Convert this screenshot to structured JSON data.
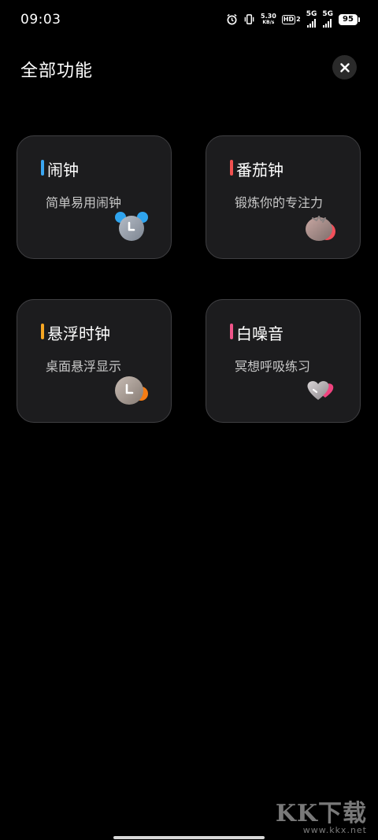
{
  "status_bar": {
    "time": "09:03",
    "net_speed_value": "5.30",
    "net_speed_unit": "KB/s",
    "hd_label": "HD",
    "hd_sub": "2",
    "sim1_label": "5G",
    "sim2_label": "5G",
    "battery": "95",
    "icons": [
      "alarm-icon",
      "vibrate-icon",
      "signal-icon",
      "signal-icon"
    ]
  },
  "header": {
    "title": "全部功能",
    "close_icon": "close-icon"
  },
  "cards": [
    {
      "title": "闹钟",
      "subtitle": "简单易用闹钟",
      "accent": "#3aa6f2",
      "icon": "alarm-clock-icon"
    },
    {
      "title": "番茄钟",
      "subtitle": "锻炼你的专注力",
      "accent": "#f0504f",
      "icon": "tomato-icon"
    },
    {
      "title": "悬浮时钟",
      "subtitle": "桌面悬浮显示",
      "accent": "#f6a623",
      "icon": "floating-clock-icon"
    },
    {
      "title": "白噪音",
      "subtitle": "冥想呼吸练习",
      "accent": "#f0558a",
      "icon": "heart-icon"
    }
  ],
  "watermark": {
    "logo": "KK下载",
    "url": "www.kkx.net"
  }
}
